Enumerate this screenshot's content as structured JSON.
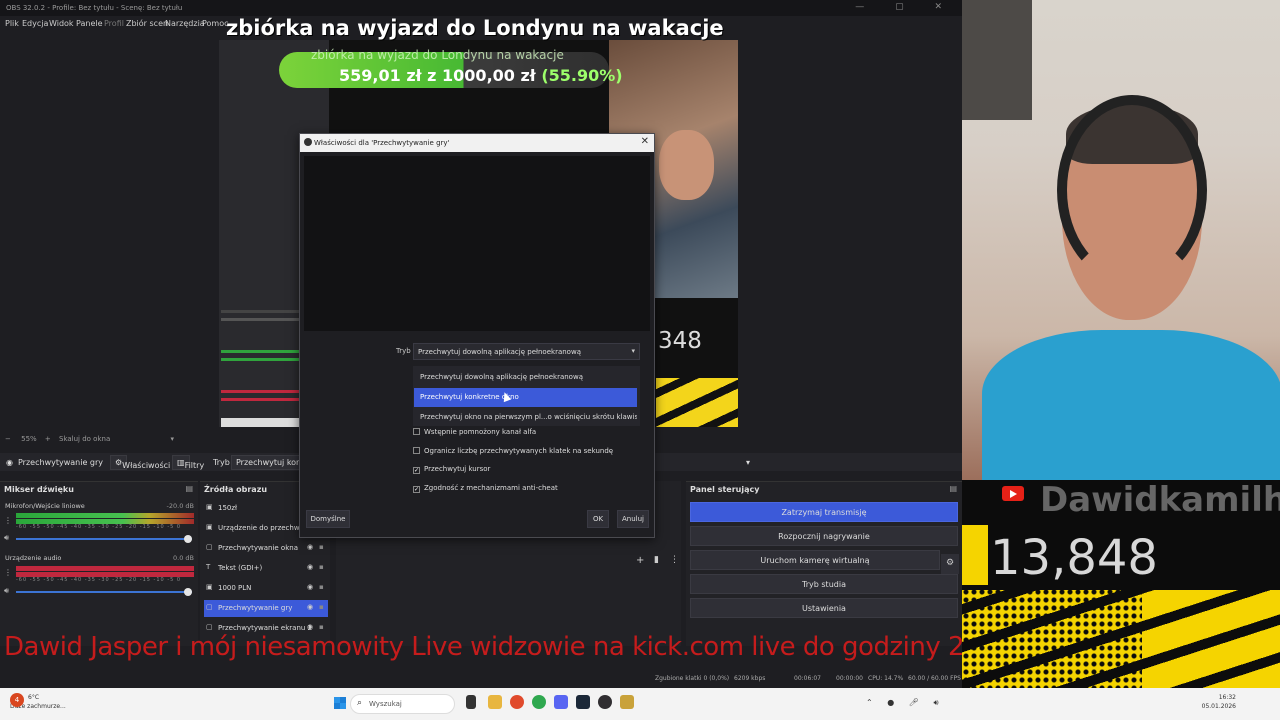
{
  "obs": {
    "title": "OBS 32.0.2 - Profile: Bez tytułu - Scenę: Bez tytułu",
    "menu": [
      "Plik",
      "Edycja",
      "Widok",
      "Panele",
      "Profil",
      "Zbiór scen",
      "Narzędzia",
      "Pomoc"
    ],
    "zoom": "55%",
    "scale_mode": "Skaluj do okna",
    "source_bar": {
      "name": "Przechwytywanie gry",
      "properties": "Właściwości",
      "filters": "Filtry",
      "mode_label": "Tryb",
      "mode_value": "Przechwytuj konkret"
    }
  },
  "overlay": {
    "headline": "zbiórka na wyjazd do Londynu na wakacje",
    "donation_title": "zbiórka na wyjazd do Londynu na wakacje",
    "donation_raised": "559,01 zł",
    "donation_of": "z",
    "donation_goal": "1000,00 zł",
    "donation_percent": "(55.90%)",
    "donation_progress": 0.559,
    "sub_count_small": "348",
    "ticker": "Dawid Jasper i mój niesamowity Live widzowie na      kick.com  live do godziny 23:59"
  },
  "mixer": {
    "title": "Mikser dźwięku",
    "channels": [
      {
        "label": "Mikrofon/Wejście liniowe",
        "db": "-20.0 dB",
        "scale": "-60 -55 -50 -45 -40 -35 -30 -25 -20 -15 -10 -5 0"
      },
      {
        "label": "Urządzenie audio",
        "db": "0.0 dB",
        "scale": "-60 -55 -50 -45 -40 -35 -30 -25 -20 -15 -10 -5 0"
      }
    ]
  },
  "sources": {
    "title": "Źródła obrazu",
    "items": [
      {
        "name": "150zł",
        "selected": false
      },
      {
        "name": "Urządzenie do przechwytywania",
        "selected": false
      },
      {
        "name": "Przechwytywanie okna",
        "selected": false
      },
      {
        "name": "Tekst (GDI+)",
        "selected": false
      },
      {
        "name": "1000 PLN",
        "selected": false
      },
      {
        "name": "Przechwytywanie gry",
        "selected": true
      },
      {
        "name": "Przechwytywanie ekranu 2",
        "selected": false
      }
    ]
  },
  "controls": {
    "title": "Panel sterujący",
    "stop_stream": "Zatrzymaj transmisję",
    "start_recording": "Rozpocznij nagrywanie",
    "virtual_cam": "Uruchom kamerę wirtualną",
    "studio_mode": "Tryb studia",
    "settings": "Ustawienia"
  },
  "status": {
    "dropped": "Zgubione klatki 0 (0,0%)",
    "bitrate": "6209 kbps",
    "live_time": "00:06:07",
    "rec_time": "00:00:00",
    "cpu": "CPU: 14.7%",
    "fps": "60.00 / 60.00 FPS"
  },
  "dialog": {
    "title": "Właściwości dla 'Przechwytywanie gry'",
    "mode_label": "Tryb",
    "mode_value": "Przechwytuj dowolną aplikację pełnoekranową",
    "options": [
      "Przechwytuj dowolną aplikację pełnoekranową",
      "Przechwytuj konkretne okno",
      "Przechwytuj okno na pierwszym pl...o wciśnięciu skrótu klawiszowego"
    ],
    "highlighted_option": 1,
    "checkboxes": [
      {
        "label": "Wstępnie pomnożony kanał alfa",
        "checked": false
      },
      {
        "label": "Ogranicz liczbę przechwytywanych klatek na sekundę",
        "checked": false
      },
      {
        "label": "Przechwytuj kursor",
        "checked": true
      },
      {
        "label": "Zgodność z mechanizmami anti-cheat",
        "checked": true
      }
    ],
    "defaults": "Domyślne",
    "ok": "OK",
    "cancel": "Anuluj"
  },
  "subwidget": {
    "name": "Dawidkamilh",
    "count": "13,848"
  },
  "taskbar": {
    "weather_temp": "6°C",
    "weather_desc": "Duże zachmurze...",
    "weather_badge": "4",
    "search_placeholder": "Wyszukaj",
    "time": "16:32",
    "date": "05.01.2026"
  },
  "colors": {
    "accent": "#3c5ad9",
    "ticker": "#d81c1c",
    "progress": "#47b933"
  }
}
